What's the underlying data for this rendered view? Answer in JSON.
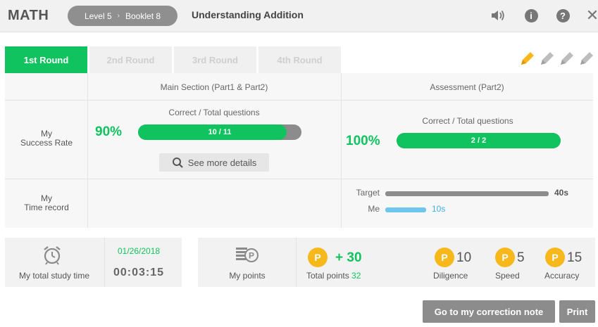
{
  "header": {
    "app_title": "MATH",
    "breadcrumb": {
      "level": "Level 5",
      "booklet": "Booklet 8"
    },
    "page_title": "Understanding Addition",
    "icons": [
      "speaker-icon",
      "info-icon",
      "help-icon",
      "close-icon"
    ]
  },
  "tabs": [
    "1st Round",
    "2nd Round",
    "3rd Round",
    "4th Round"
  ],
  "active_tab": 0,
  "pencils": {
    "filled": 1,
    "total": 4,
    "filled_color": "#f6b81b",
    "empty_color": "#bdbdbd"
  },
  "results": {
    "main_section": {
      "header": "Main Section (Part1 & Part2)",
      "subheader": "Correct / Total questions",
      "percent": "90%",
      "bar_label": "10 / 11",
      "correct": 10,
      "total": 11,
      "details_button": "See more details"
    },
    "assessment": {
      "header": "Assessment (Part2)",
      "subheader": "Correct / Total questions",
      "percent": "100%",
      "bar_label": "2 / 2",
      "correct": 2,
      "total": 2
    },
    "row_labels": {
      "success_rate_line1": "My",
      "success_rate_line2": "Success Rate",
      "time_record_line1": "My",
      "time_record_line2": "Time record"
    },
    "time_record": {
      "target_label": "Target",
      "target_value": "40s",
      "target_seconds": 40,
      "me_label": "Me",
      "me_value": "10s",
      "me_seconds": 10
    }
  },
  "study": {
    "label": "My total study time",
    "date": "01/26/2018",
    "time": "00:03:15"
  },
  "points": {
    "label": "My points",
    "gained": "+ 30",
    "total_label": "Total points",
    "total_value": "32",
    "diligence_value": "10",
    "diligence_label": "Diligence",
    "speed_value": "5",
    "speed_label": "Speed",
    "accuracy_value": "15",
    "accuracy_label": "Accuracy",
    "coin_letter": "P"
  },
  "footer": {
    "correction_button": "Go to my correction note",
    "print_button": "Print"
  },
  "colors": {
    "accent": "#10c35e",
    "bar_gray": "#8c8c8c",
    "time_target": "#8c8c8c",
    "time_me": "#6cc6ee",
    "coin": "#f6b81b"
  }
}
